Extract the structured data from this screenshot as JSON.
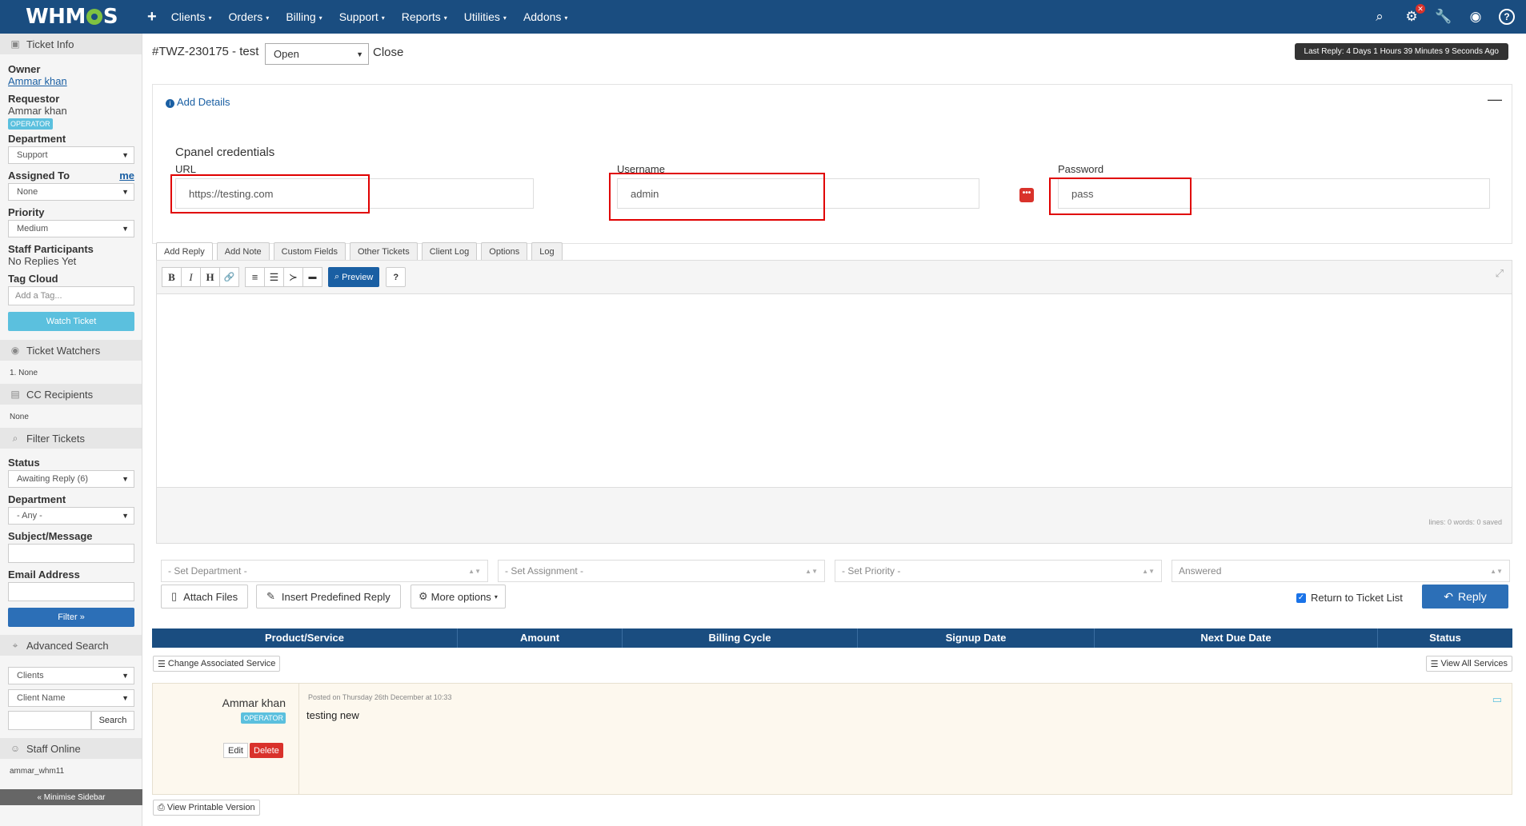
{
  "nav": {
    "logo_pre": "WHM",
    "logo_post": "S",
    "plus": "+",
    "items": [
      "Clients",
      "Orders",
      "Billing",
      "Support",
      "Reports",
      "Utilities",
      "Addons"
    ],
    "caret": "▾",
    "icons": {
      "search": "⌕",
      "cog": "⚙",
      "cog_badge": "✕",
      "wrench": "🔧",
      "user": "◉",
      "help": "?"
    }
  },
  "sidebar": {
    "ticket_info": {
      "title": "Ticket Info",
      "owner_label": "Owner",
      "owner_value": "Ammar khan",
      "requestor_label": "Requestor",
      "requestor_value": "Ammar khan",
      "operator_badge": "OPERATOR",
      "department_label": "Department",
      "department_value": "Support",
      "assigned_label": "Assigned To",
      "assigned_me": "me",
      "assigned_value": "None",
      "priority_label": "Priority",
      "priority_value": "Medium",
      "staff_label": "Staff Participants",
      "staff_value": "No Replies Yet",
      "tag_label": "Tag Cloud",
      "tag_placeholder": "Add a Tag...",
      "watch_button": "Watch Ticket"
    },
    "watchers": {
      "title": "Ticket Watchers",
      "value": "1. None"
    },
    "cc": {
      "title": "CC Recipients",
      "value": "None"
    },
    "filter": {
      "title": "Filter Tickets",
      "status_label": "Status",
      "status_value": "Awaiting Reply (6)",
      "department_label": "Department",
      "department_value": "- Any -",
      "subject_label": "Subject/Message",
      "email_label": "Email Address",
      "filter_button": "Filter »"
    },
    "advanced": {
      "title": "Advanced Search",
      "type_value": "Clients",
      "field_value": "Client Name",
      "search_button": "Search"
    },
    "staff_online": {
      "title": "Staff Online",
      "value": "ammar_whm11"
    },
    "minimise": "« Minimise Sidebar"
  },
  "ticket": {
    "title": "#TWZ-230175 - test",
    "status": "Open",
    "close": "Close",
    "last_reply": "Last Reply: 4 Days 1 Hours 39 Minutes 9 Seconds Ago"
  },
  "details": {
    "add_details": "Add Details",
    "collapse": "—",
    "cred_title": "Cpanel credentials",
    "url_label": "URL",
    "url_value": "https://testing.com",
    "username_label": "Username",
    "username_value": "admin",
    "password_label": "Password",
    "password_value": "pass",
    "dots": "•••"
  },
  "tabs": [
    "Add Reply",
    "Add Note",
    "Custom Fields",
    "Other Tickets",
    "Client Log",
    "Options",
    "Log"
  ],
  "editor": {
    "tools": [
      "B",
      "I",
      "H",
      "🔗",
      "≡",
      "☰",
      "≻",
      "▬"
    ],
    "preview": "Preview",
    "help": "?",
    "expand": "⤢",
    "stats": "lines: 0   words: 0   saved"
  },
  "reply_form": {
    "set_department": "- Set Department -",
    "set_assignment": "- Set Assignment -",
    "set_priority": "- Set Priority -",
    "status": "Answered",
    "attach_files": "Attach Files",
    "insert_predefined": "Insert Predefined Reply",
    "more_options": "More options",
    "return_to_list": "Return to Ticket List",
    "reply_button": "Reply"
  },
  "services": {
    "columns": [
      "Product/Service",
      "Amount",
      "Billing Cycle",
      "Signup Date",
      "Next Due Date",
      "Status"
    ],
    "change_service": "Change Associated Service",
    "view_all": "View All Services"
  },
  "reply": {
    "author": "Ammar khan",
    "badge": "OPERATOR",
    "edit": "Edit",
    "delete": "Delete",
    "posted": "Posted on Thursday 26th December at 10:33",
    "message": "testing new"
  },
  "printable": "View Printable Version"
}
